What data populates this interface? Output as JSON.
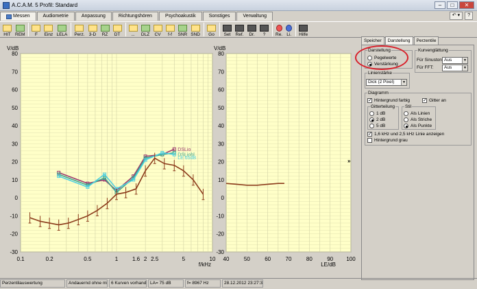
{
  "window": {
    "title": "A.C.A.M. 5 Profil: Standard"
  },
  "window_buttons": [
    "–",
    "□",
    "✕"
  ],
  "main_tabs": [
    {
      "label": "Messen",
      "active": true
    },
    {
      "label": "Audiometrie"
    },
    {
      "label": "Anpassung"
    },
    {
      "label": "Richtungshören"
    },
    {
      "label": "Psychoakustik"
    },
    {
      "label": "Sonstiges"
    },
    {
      "label": "Verwaltung"
    }
  ],
  "header_controls": {
    "undo": "↶ ▾",
    "help": "?"
  },
  "toolbar": [
    {
      "label": "HIT",
      "icon": "hit-icon"
    },
    {
      "label": "REM",
      "icon": "rem-icon"
    },
    {
      "label": "F",
      "icon": "f-icon"
    },
    {
      "label": "Einz",
      "icon": "einzel-icon"
    },
    {
      "label": "LELA",
      "icon": "lela-icon"
    },
    {
      "label": "Perz.",
      "icon": "perzentile-icon"
    },
    {
      "label": "3-D",
      "icon": "3d-icon"
    },
    {
      "label": "RZ",
      "icon": "rz-icon"
    },
    {
      "label": "DT",
      "icon": "dt-icon"
    },
    {
      "label": "...",
      "icon": "more-icon"
    },
    {
      "label": "DLZ",
      "icon": "dlz-icon"
    },
    {
      "label": "CV",
      "icon": "cv-icon"
    },
    {
      "label": "f-f",
      "icon": "ff-icon"
    },
    {
      "label": "SNR",
      "icon": "snr-icon"
    },
    {
      "label": "SND",
      "icon": "snd-icon"
    },
    {
      "label": "Go",
      "icon": "go-icon"
    },
    {
      "label": "Set",
      "icon": "tools-icon"
    },
    {
      "label": "Ref.",
      "icon": "glasses-icon"
    },
    {
      "label": "Dr.",
      "icon": "printer-icon"
    },
    {
      "label": "?",
      "icon": "question-icon"
    },
    {
      "label": "Re.",
      "icon": "right-ear-icon"
    },
    {
      "label": "Li.",
      "icon": "left-ear-icon"
    },
    {
      "label": "Hilfe",
      "icon": "help-icon"
    }
  ],
  "panel": {
    "tabs": [
      {
        "label": "Speicher"
      },
      {
        "label": "Darstellung",
        "active": true
      },
      {
        "label": "Perzentile"
      }
    ],
    "darstellung": {
      "legend": "Darstellung",
      "options": [
        "Pegelwerte",
        "Verstärkung"
      ],
      "selected": 1
    },
    "kurvenglaettung": {
      "legend": "Kurvenglättung",
      "sinuston_label": "Für Sinuston:",
      "sinuston_value": "Aus",
      "fft_label": "Für FFT:",
      "fft_value": "Aus"
    },
    "linienstaerke": {
      "legend": "Linienstärke",
      "value": "Dick (2 Pixel)"
    },
    "diagramm": {
      "legend": "Diagramm",
      "hintergrund_farbig": "Hintergrund farbig",
      "gitter_an": "Gitter an",
      "gitterteilung": {
        "legend": "Gitterteilung",
        "options": [
          "1 dB",
          "2 dB",
          "5 dB"
        ],
        "selected": 1
      },
      "stil": {
        "legend": "Stil",
        "options": [
          "Als Linien",
          "Als Striche",
          "Als Punkte"
        ],
        "selected": 2
      },
      "linie_anzeigen": "1,6 kHz und 2,5 kHz Linie anzeigen",
      "hintergrund_grau": "Hintergrund grau"
    }
  },
  "status": [
    "Perzentilauswertung",
    "Andauernd ohne mitte",
    "6 Kurven vorhanden",
    "LA= 75 dB",
    "f= 8967 Hz",
    "28.12.2012 23:27:39"
  ],
  "chevron": "»",
  "colors": {
    "plot_bg": "#ffffc8",
    "grid": "#e3e3b0",
    "brown": "#8b3a1a",
    "purple": "#9b3b6e",
    "green": "#3ea58f",
    "cyan": "#4fd0e0",
    "highlight": "#d8202a"
  },
  "chart_data": {
    "type": "line",
    "left_plot": {
      "xlabel": "f/kHz",
      "ylabel": "V/dB",
      "x_scale": "log",
      "xlim": [
        0.1,
        10
      ],
      "ylim": [
        -30,
        80
      ],
      "x_tick_labels": [
        "0.1",
        "0.2",
        "0.5",
        "1",
        "1.6",
        "2",
        "2.5",
        "5",
        "10"
      ],
      "x_ticks": [
        0.1,
        0.2,
        0.5,
        1,
        1.6,
        2,
        2.5,
        5,
        10
      ],
      "y_ticks": [
        -30,
        -20,
        -10,
        0,
        10,
        20,
        30,
        40,
        50,
        60,
        70,
        80
      ],
      "series": [
        {
          "name": "DSLio",
          "color": "#9b3b6e",
          "x": [
            0.25,
            0.5,
            0.75,
            1,
            1.5,
            2,
            3,
            4
          ],
          "y": [
            14,
            8,
            10,
            4,
            12,
            23,
            24,
            27
          ]
        },
        {
          "name": "DSLiohl",
          "color": "#3ea58f",
          "x": [
            0.25,
            0.5,
            0.75,
            1,
            1.5,
            2,
            3,
            4
          ],
          "y": [
            13,
            7,
            11,
            3,
            11,
            22,
            24,
            25
          ]
        },
        {
          "name": "LE 65dB",
          "color": "#4fd0e0",
          "x": [
            0.25,
            0.5,
            0.75,
            1,
            1.5,
            2,
            3,
            4
          ],
          "y": [
            12,
            6,
            13,
            5,
            10,
            21,
            25,
            24
          ]
        },
        {
          "name": "Gain",
          "color": "#8b3a1a",
          "x": [
            0.125,
            0.16,
            0.2,
            0.25,
            0.315,
            0.4,
            0.5,
            0.63,
            0.8,
            1,
            1.25,
            1.6,
            2,
            2.5,
            3.15,
            4,
            5,
            6.3,
            8
          ],
          "y": [
            -11,
            -13,
            -14,
            -15,
            -14,
            -12,
            -10,
            -7,
            -3,
            2,
            3,
            5,
            15,
            22,
            19,
            18,
            15,
            10,
            2
          ]
        }
      ]
    },
    "right_plot": {
      "xlabel": "LE/dB",
      "xlim": [
        40,
        100
      ],
      "x_ticks": [
        40,
        50,
        60,
        70,
        80,
        90,
        100
      ],
      "ylim": [
        -30,
        80
      ],
      "series": [
        {
          "color": "#8b3a1a",
          "x": [
            40,
            45,
            50,
            55,
            60,
            65,
            68
          ],
          "y": [
            8,
            7.5,
            7,
            7,
            7.5,
            8,
            8
          ]
        }
      ]
    }
  }
}
